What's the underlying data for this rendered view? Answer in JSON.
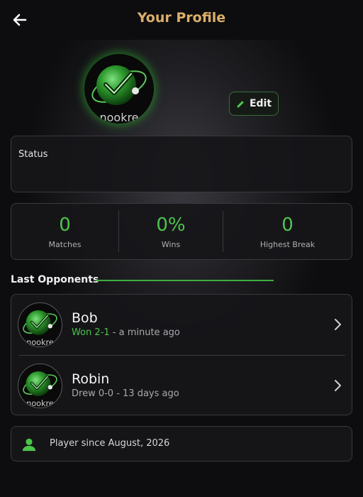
{
  "header": {
    "title": "Your Profile",
    "back_icon": "arrow-left-icon"
  },
  "profile": {
    "avatar_text": "nookre",
    "edit_label": "Edit",
    "edit_icon": "pencil-icon",
    "status_label": "Status"
  },
  "stats": [
    {
      "value": "0",
      "label": "Matches"
    },
    {
      "value": "0%",
      "label": "Wins"
    },
    {
      "value": "0",
      "label": "Highest Break"
    }
  ],
  "last_opponents": {
    "title": "Last Opponents",
    "items": [
      {
        "name": "Bob",
        "result": "Won 2-1",
        "time": " - a minute ago",
        "avatar_text": "nookre"
      },
      {
        "name": "Robin",
        "result": "Drew 0-0",
        "time": " - 13 days ago",
        "avatar_text": "nookre"
      }
    ]
  },
  "player_since": {
    "text": "Player since August, 2026",
    "icon": "person-icon"
  },
  "colors": {
    "accent": "#4cc44c",
    "title": "#dcae6a",
    "background": "#0b0b0d"
  }
}
